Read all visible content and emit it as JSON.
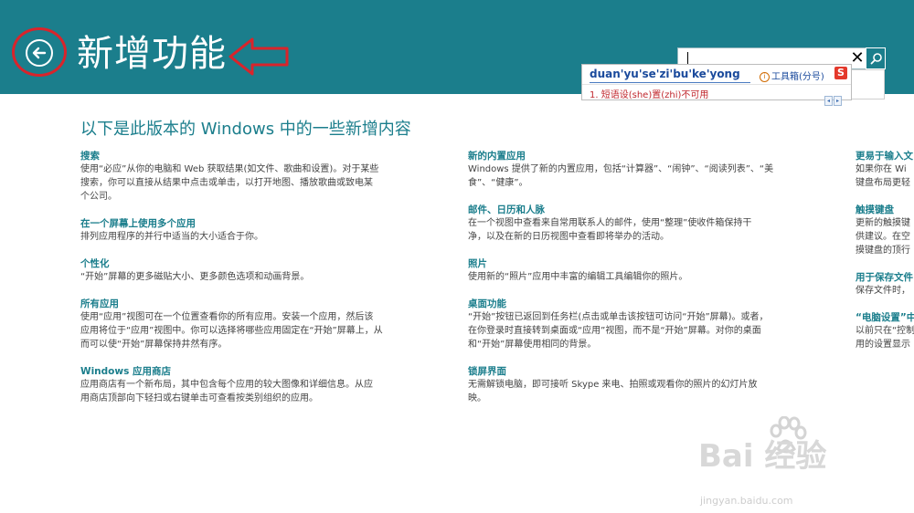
{
  "colors": {
    "header_bg": "#1b7e8c",
    "accent": "#1b7e8c",
    "annotation": "#d9242b",
    "body_text": "#444444"
  },
  "header": {
    "title": "新增功能",
    "back_icon": "back-arrow-icon"
  },
  "search": {
    "value": "",
    "clear_label": "✕",
    "search_icon": "magnifier-icon"
  },
  "ime": {
    "pinyin": "duan'yu'se'zi'bu'ke'yong",
    "toolbox_label": "工具箱(分号)",
    "candidate": "1. 短语设(she)置(zhi)不可用",
    "logo_label": "S"
  },
  "intro": "以下是此版本的 Windows 中的一些新增内容",
  "columns": [
    [
      {
        "title": "搜索",
        "lines": [
          "使用“必应”从你的电脑和 Web 获取结果(如文件、歌曲和设置)。对于某些",
          "搜索，你可以直接从结果中点击或单击，以打开地图、播放歌曲或致电某",
          "个公司。"
        ]
      },
      {
        "title": "在一个屏幕上使用多个应用",
        "lines": [
          "排列应用程序的并行中适当的大小适合于你。"
        ]
      },
      {
        "title": "个性化",
        "lines": [
          "“开始”屏幕的更多磁贴大小、更多颜色选项和动画背景。"
        ]
      },
      {
        "title": "所有应用",
        "lines": [
          "使用“应用”视图可在一个位置查看你的所有应用。安装一个应用，然后该",
          "应用将位于“应用”视图中。你可以选择将哪些应用固定在“开始”屏幕上，从",
          "而可以使“开始”屏幕保持井然有序。"
        ]
      },
      {
        "title": "Windows 应用商店",
        "lines": [
          "应用商店有一个新布局，其中包含每个应用的较大图像和详细信息。从应",
          "用商店顶部向下轻扫或右键单击可查看按类别组织的应用。"
        ]
      }
    ],
    [
      {
        "title": "新的内置应用",
        "lines": [
          "Windows 提供了新的内置应用，包括“计算器”、“闹钟”、“阅读列表”、“美",
          "食”、“健康”。"
        ]
      },
      {
        "title": "邮件、日历和人脉",
        "lines": [
          "在一个视图中查看来自常用联系人的邮件，使用“整理”使收件箱保持干",
          "净，以及在新的日历视图中查看即将举办的活动。"
        ]
      },
      {
        "title": "照片",
        "lines": [
          "使用新的“照片”应用中丰富的编辑工具编辑你的照片。"
        ]
      },
      {
        "title": "桌面功能",
        "lines": [
          "“开始”按钮已返回到任务栏(点击或单击该按钮可访问“开始”屏幕)。或者，",
          "在你登录时直接转到桌面或“应用”视图，而不是“开始”屏幕。对你的桌面",
          "和“开始”屏幕使用相同的背景。"
        ]
      },
      {
        "title": "锁屏界面",
        "lines": [
          "无需解锁电脑，即可接听 Skype 来电、拍照或观看你的照片的幻灯片放",
          "映。"
        ]
      }
    ],
    [
      {
        "title": "更易于输入文",
        "lines": [
          "如果你在 Wi",
          "键盘布局更轻"
        ]
      },
      {
        "title": "触摸键盘",
        "lines": [
          "更新的触摸键",
          "供建议。在空",
          "摸键盘的顶行"
        ]
      },
      {
        "title": "用于保存文件",
        "lines": [
          "保存文件时，"
        ]
      },
      {
        "title": "“电脑设置”中",
        "lines": [
          "以前只在“控制",
          "用的设置显示"
        ]
      }
    ]
  ],
  "watermark": {
    "brand": "Bai  经验",
    "url": "jingyan.baidu.com"
  }
}
